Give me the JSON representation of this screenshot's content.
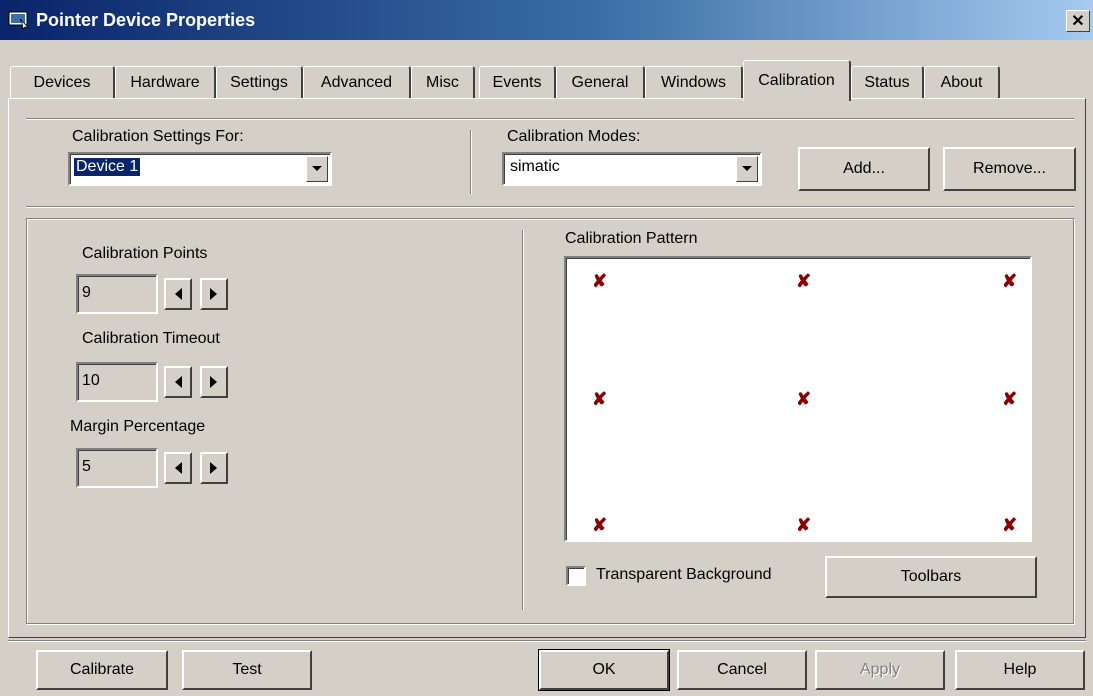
{
  "window": {
    "title": "Pointer Device Properties",
    "close_glyph": "✕"
  },
  "tabs": [
    {
      "label": "Devices"
    },
    {
      "label": "Hardware"
    },
    {
      "label": "Settings"
    },
    {
      "label": "Advanced"
    },
    {
      "label": "Misc"
    },
    {
      "label": "Events"
    },
    {
      "label": "General"
    },
    {
      "label": "Windows"
    },
    {
      "label": "Calibration",
      "active": true
    },
    {
      "label": "Status"
    },
    {
      "label": "About"
    }
  ],
  "calibration_settings": {
    "label": "Calibration Settings For:",
    "selected": "Device 1"
  },
  "calibration_modes": {
    "label": "Calibration Modes:",
    "selected": "simatic",
    "add_label": "Add...",
    "remove_label": "Remove..."
  },
  "points": {
    "label": "Calibration Points",
    "value": "9"
  },
  "timeout": {
    "label": "Calibration Timeout",
    "value": "10"
  },
  "margin": {
    "label": "Margin Percentage",
    "value": "5"
  },
  "pattern": {
    "label": "Calibration Pattern",
    "marker_glyph": "✘",
    "marker_color": "#8b0000",
    "rows": 3,
    "cols": 3
  },
  "transparent": {
    "label": "Transparent Background",
    "checked": false
  },
  "toolbars_label": "Toolbars",
  "footer": {
    "calibrate": "Calibrate",
    "test": "Test",
    "ok": "OK",
    "cancel": "Cancel",
    "apply": "Apply",
    "help": "Help"
  },
  "colors": {
    "face": "#d4d0c8",
    "title_start": "#0a246a",
    "title_end": "#a6caf0",
    "selection": "#0a246a"
  }
}
